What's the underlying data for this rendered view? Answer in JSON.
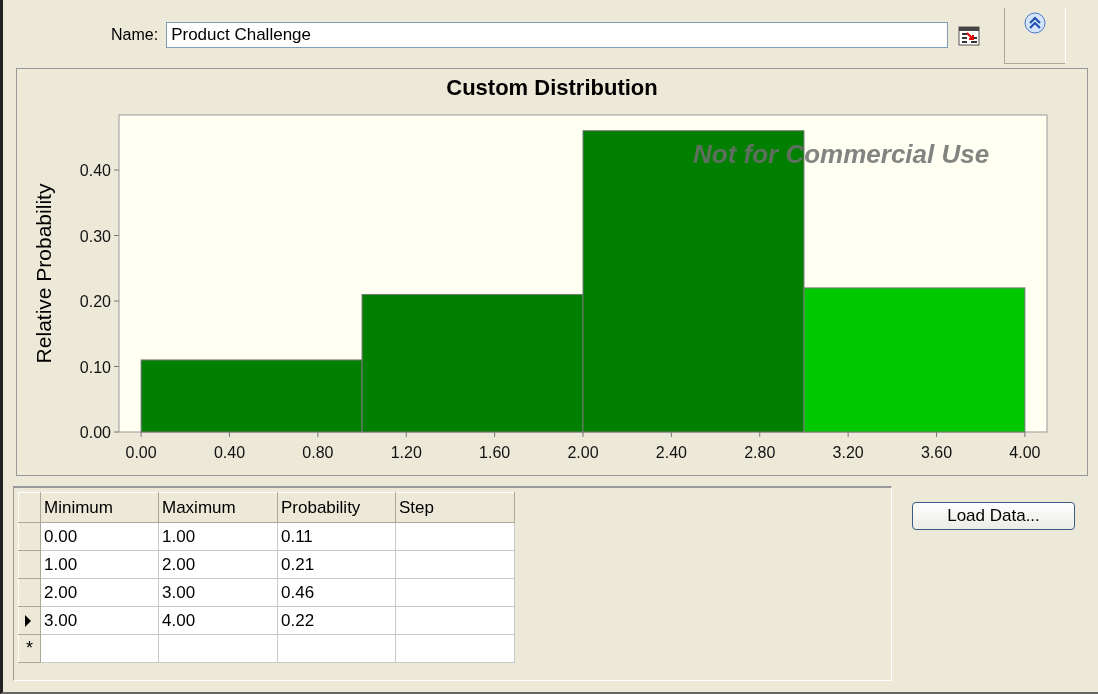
{
  "name_field": {
    "label": "Name:",
    "value": "Product Challenge"
  },
  "chart": {
    "notice": "Not for Commercial Use",
    "chart_data": {
      "type": "bar",
      "title": "Custom Distribution",
      "ylabel": "Relative Probability",
      "x": [
        0.5,
        1.5,
        2.5,
        3.5
      ],
      "series": [
        {
          "color": "#007f00",
          "values": [
            0.11,
            0.21,
            0.46,
            null
          ]
        },
        {
          "color": "#00c800",
          "values": [
            null,
            null,
            null,
            0.22
          ]
        }
      ],
      "xlim": [
        -0.1,
        4.1
      ],
      "ylim": [
        0,
        0.484
      ],
      "xticks": [
        {
          "value": 0,
          "label": "0.00"
        },
        {
          "value": 0.4,
          "label": "0.40"
        },
        {
          "value": 0.8,
          "label": "0.80"
        },
        {
          "value": 1.2,
          "label": "1.20"
        },
        {
          "value": 1.6,
          "label": "1.60"
        },
        {
          "value": 2,
          "label": "2.00"
        },
        {
          "value": 2.4,
          "label": "2.40"
        },
        {
          "value": 2.8,
          "label": "2.80"
        },
        {
          "value": 3.2,
          "label": "3.20"
        },
        {
          "value": 3.6,
          "label": "3.60"
        },
        {
          "value": 4,
          "label": "4.00"
        }
      ],
      "yticks": [
        {
          "value": 0,
          "label": "0.00"
        },
        {
          "value": 0.1,
          "label": "0.10"
        },
        {
          "value": 0.2,
          "label": "0.20"
        },
        {
          "value": 0.3,
          "label": "0.30"
        },
        {
          "value": 0.4,
          "label": "0.40"
        }
      ]
    }
  },
  "table": {
    "columns": [
      "Minimum",
      "Maximum",
      "Probability",
      "Step"
    ],
    "rows": [
      {
        "cells": [
          "0.00",
          "1.00",
          "0.11",
          ""
        ],
        "selected": false
      },
      {
        "cells": [
          "1.00",
          "2.00",
          "0.21",
          ""
        ],
        "selected": false
      },
      {
        "cells": [
          "2.00",
          "3.00",
          "0.46",
          ""
        ],
        "selected": false
      },
      {
        "cells": [
          "3.00",
          "4.00",
          "0.22",
          ""
        ],
        "selected": true
      }
    ],
    "new_row_marker": "*"
  },
  "buttons": [
    {
      "label": "Load Data..."
    }
  ]
}
